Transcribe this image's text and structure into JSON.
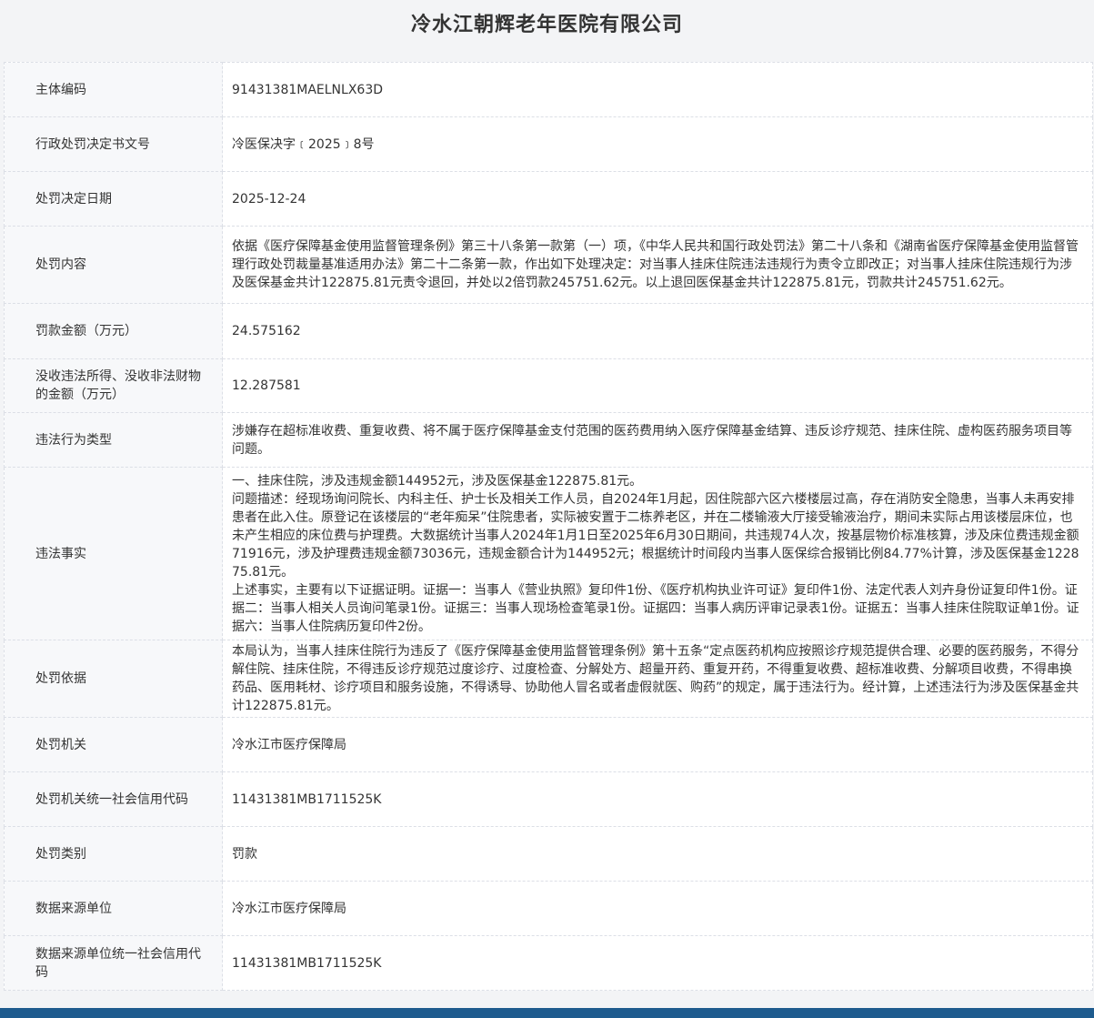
{
  "title": "冷水江朝辉老年医院有限公司",
  "rows": [
    {
      "label": "主体编码",
      "value": [
        "91431381MAELNLX63D"
      ]
    },
    {
      "label": "行政处罚决定书文号",
      "value": [
        "冷医保决字﹝2025﹞8号"
      ]
    },
    {
      "label": "处罚决定日期",
      "value": [
        "2025-12-24"
      ]
    },
    {
      "label": "处罚内容",
      "value": [
        "依据《医疗保障基金使用监督管理条例》第三十八条第一款第（一）项，《中华人民共和国行政处罚法》第二十八条和《湖南省医疗保障基金使用监督管理行政处罚裁量基准适用办法》第二十二条第一款，作出如下处理决定：对当事人挂床住院违法违规行为责令立即改正；对当事人挂床住院违规行为涉及医保基金共计122875.81元责令退回，并处以2倍罚款245751.62元。以上退回医保基金共计122875.81元，罚款共计245751.62元。"
      ]
    },
    {
      "label": "罚款金额（万元）",
      "value": [
        "24.575162"
      ]
    },
    {
      "label": "没收违法所得、没收非法财物的金额（万元）",
      "value": [
        "12.287581"
      ]
    },
    {
      "label": "违法行为类型",
      "value": [
        "涉嫌存在超标准收费、重复收费、将不属于医疗保障基金支付范围的医药费用纳入医疗保障基金结算、违反诊疗规范、挂床住院、虚构医药服务项目等问题。"
      ]
    },
    {
      "label": "违法事实",
      "value": [
        "一、挂床住院，涉及违规金额144952元，涉及医保基金122875.81元。",
        "问题描述：经现场询问院长、内科主任、护士长及相关工作人员，自2024年1月起，因住院部六区六楼楼层过高，存在消防安全隐患，当事人未再安排患者在此入住。原登记在该楼层的“老年痴呆”住院患者，实际被安置于二栋养老区，并在二楼输液大厅接受输液治疗，期间未实际占用该楼层床位，也未产生相应的床位费与护理费。大数据统计当事人2024年1月1日至2025年6月30日期间，共违规74人次，按基层物价标准核算，涉及床位费违规金额71916元，涉及护理费违规金额73036元，违规金额合计为144952元；根据统计时间段内当事人医保综合报销比例84.77%计算，涉及医保基金122875.81元。",
        "上述事实，主要有以下证据证明。证据一：当事人《营业执照》复印件1份、《医疗机构执业许可证》复印件1份、法定代表人刘卉身份证复印件1份。证据二：当事人相关人员询问笔录1份。证据三：当事人现场检查笔录1份。证据四：当事人病历评审记录表1份。证据五：当事人挂床住院取证单1份。证据六：当事人住院病历复印件2份。"
      ]
    },
    {
      "label": "处罚依据",
      "value": [
        "本局认为，当事人挂床住院行为违反了《医疗保障基金使用监督管理条例》第十五条“定点医药机构应按照诊疗规范提供合理、必要的医药服务，不得分解住院、挂床住院，不得违反诊疗规范过度诊疗、过度检查、分解处方、超量开药、重复开药，不得重复收费、超标准收费、分解项目收费，不得串换药品、医用耗材、诊疗项目和服务设施，不得诱导、协助他人冒名或者虚假就医、购药”的规定，属于违法行为。经计算，上述违法行为涉及医保基金共计122875.81元。"
      ]
    },
    {
      "label": "处罚机关",
      "value": [
        "冷水江市医疗保障局"
      ]
    },
    {
      "label": "处罚机关统一社会信用代码",
      "value": [
        "11431381MB1711525K"
      ]
    },
    {
      "label": "处罚类别",
      "value": [
        "罚款"
      ]
    },
    {
      "label": "数据来源单位",
      "value": [
        "冷水江市医疗保障局"
      ]
    },
    {
      "label": "数据来源单位统一社会信用代码",
      "value": [
        "11431381MB1711525K"
      ]
    }
  ],
  "colors": {
    "background": "#f3f4f6",
    "label_cell": "#f7f8fa",
    "border": "#dcdfe6",
    "footer": "#1e5b8e"
  }
}
